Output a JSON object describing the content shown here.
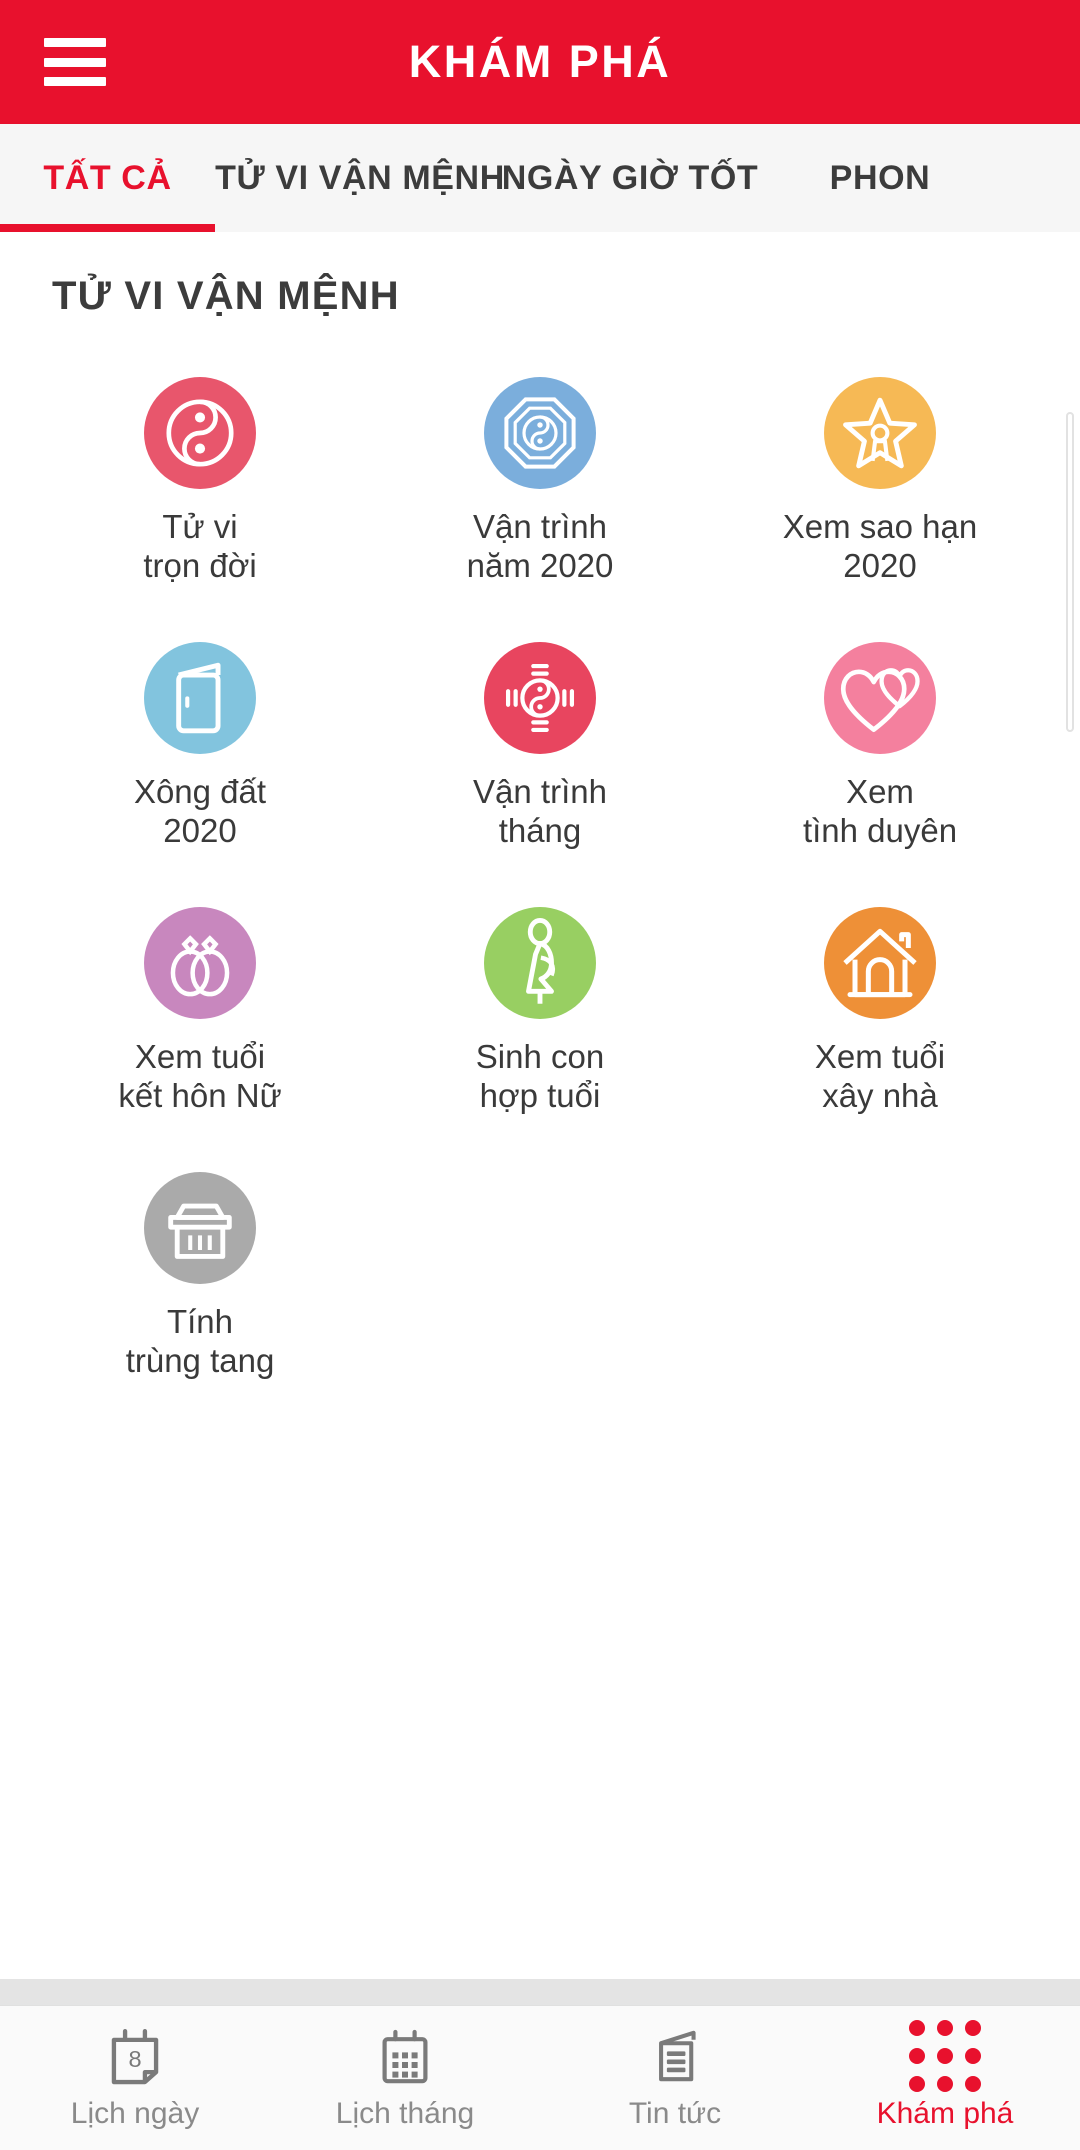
{
  "header": {
    "title": "KHÁM PHÁ",
    "menu_icon": "hamburger-menu-icon",
    "background_color": "#E8112D"
  },
  "tabs": {
    "active_index": 0,
    "items": [
      {
        "label": "TẤT CẢ"
      },
      {
        "label": "TỬ VI VẬN MỆNH"
      },
      {
        "label": "NGÀY GIỜ TỐT"
      },
      {
        "label": "PHON"
      }
    ]
  },
  "section": {
    "title": "TỬ VI VẬN MỆNH"
  },
  "grid_items": [
    {
      "label": "Tử vi\ntrọn đời",
      "icon": "yin-yang-icon",
      "color": "#E8566C"
    },
    {
      "label": "Vận trình\nnăm 2020",
      "icon": "octagon-yinyang-icon",
      "color": "#7BAEDC"
    },
    {
      "label": "Xem sao hạn\n2020",
      "icon": "star-person-icon",
      "color": "#F6B955"
    },
    {
      "label": "Xông đất\n2020",
      "icon": "door-icon",
      "color": "#82C4DE"
    },
    {
      "label": "Vận trình\ntháng",
      "icon": "bagua-yinyang-icon",
      "color": "#E8455F"
    },
    {
      "label": "Xem\ntình duyên",
      "icon": "two-hearts-icon",
      "color": "#F4809E"
    },
    {
      "label": "Xem tuổi\nkết hôn Nữ",
      "icon": "wedding-rings-icon",
      "color": "#C887BE"
    },
    {
      "label": "Sinh con\nhợp tuổi",
      "icon": "pregnant-woman-icon",
      "color": "#98CF62"
    },
    {
      "label": "Xem tuổi\nxây nhà",
      "icon": "house-icon",
      "color": "#EE9037"
    },
    {
      "label": "Tính\ntrùng tang",
      "icon": "tomb-shrine-icon",
      "color": "#AAAAAA"
    }
  ],
  "bottom_nav": {
    "active_index": 3,
    "items": [
      {
        "label": "Lịch ngày",
        "icon": "day-calendar-icon",
        "badge": "8"
      },
      {
        "label": "Lịch tháng",
        "icon": "month-calendar-icon"
      },
      {
        "label": "Tin tức",
        "icon": "news-icon"
      },
      {
        "label": "Khám phá",
        "icon": "grid-dots-icon"
      }
    ]
  }
}
